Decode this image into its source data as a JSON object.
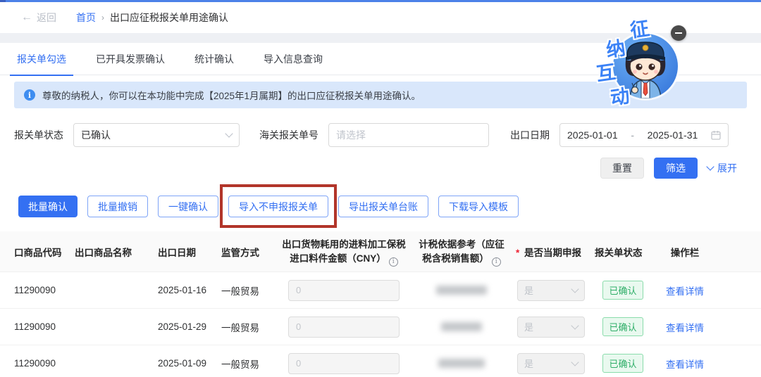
{
  "breadcrumb": {
    "back_label": "返回",
    "home": "首页",
    "separator": "›",
    "current": "出口应征税报关单用途确认"
  },
  "tabs": [
    {
      "label": "报关单勾选",
      "active": true
    },
    {
      "label": "已开具发票确认",
      "active": false
    },
    {
      "label": "统计确认",
      "active": false
    },
    {
      "label": "导入信息查询",
      "active": false
    }
  ],
  "banner": {
    "icon": "info-icon",
    "text": "尊敬的纳税人，你可以在本功能中完成【2025年1月属期】的出口应征税报关单用途确认。"
  },
  "filters": {
    "status_label": "报关单状态",
    "status_value": "已确认",
    "customs_no_label": "海关报关单号",
    "customs_no_placeholder": "请选择",
    "date_label": "出口日期",
    "date_start": "2025-01-01",
    "date_separator": "-",
    "date_end": "2025-01-31",
    "reset_label": "重置",
    "filter_label": "筛选",
    "expand_label": "展开"
  },
  "actions": {
    "batch_confirm": "批量确认",
    "batch_revoke": "批量撤销",
    "one_click_confirm": "一键确认",
    "import_undeclared": "导入不申报报关单",
    "export_ledger": "导出报关单台账",
    "download_template": "下载导入模板"
  },
  "table": {
    "headers": {
      "code": "口商品代码",
      "name": "出口商品名称",
      "date": "出口日期",
      "mode": "监管方式",
      "bonded": "出口货物耗用的进料加工保税进口料件金额（CNY）",
      "taxbase": "计税依据参考（应征税含税销售额）",
      "declare": "是否当期申报",
      "declare_required_mark": "*",
      "status": "报关单状态",
      "action": "操作栏"
    },
    "rows": [
      {
        "code": "11290090",
        "name": "",
        "date": "2025-01-16",
        "mode": "一般贸易",
        "bonded_value": "0",
        "taxbase_masked": true,
        "declare_value": "是",
        "status": "已确认",
        "action": "查看详情"
      },
      {
        "code": "11290090",
        "name": "",
        "date": "2025-01-29",
        "mode": "一般贸易",
        "bonded_value": "0",
        "taxbase_masked": true,
        "declare_value": "是",
        "status": "已确认",
        "action": "查看详情"
      },
      {
        "code": "11290090",
        "name": "",
        "date": "2025-01-09",
        "mode": "一般贸易",
        "bonded_value": "0",
        "taxbase_masked": true,
        "declare_value": "是",
        "status": "已确认",
        "action": "查看详情"
      }
    ]
  },
  "mascot": {
    "chars": {
      "c1": "征",
      "c2": "纳",
      "c3": "互",
      "c4": "动"
    },
    "minimize_icon": "minus-icon"
  },
  "colors": {
    "accent_blue": "#3470f2",
    "highlight_red_box": "#b2352a",
    "badge_green_text": "#2fae68",
    "badge_green_bg": "#e9f9ef",
    "banner_bg": "#d9e7fb"
  }
}
